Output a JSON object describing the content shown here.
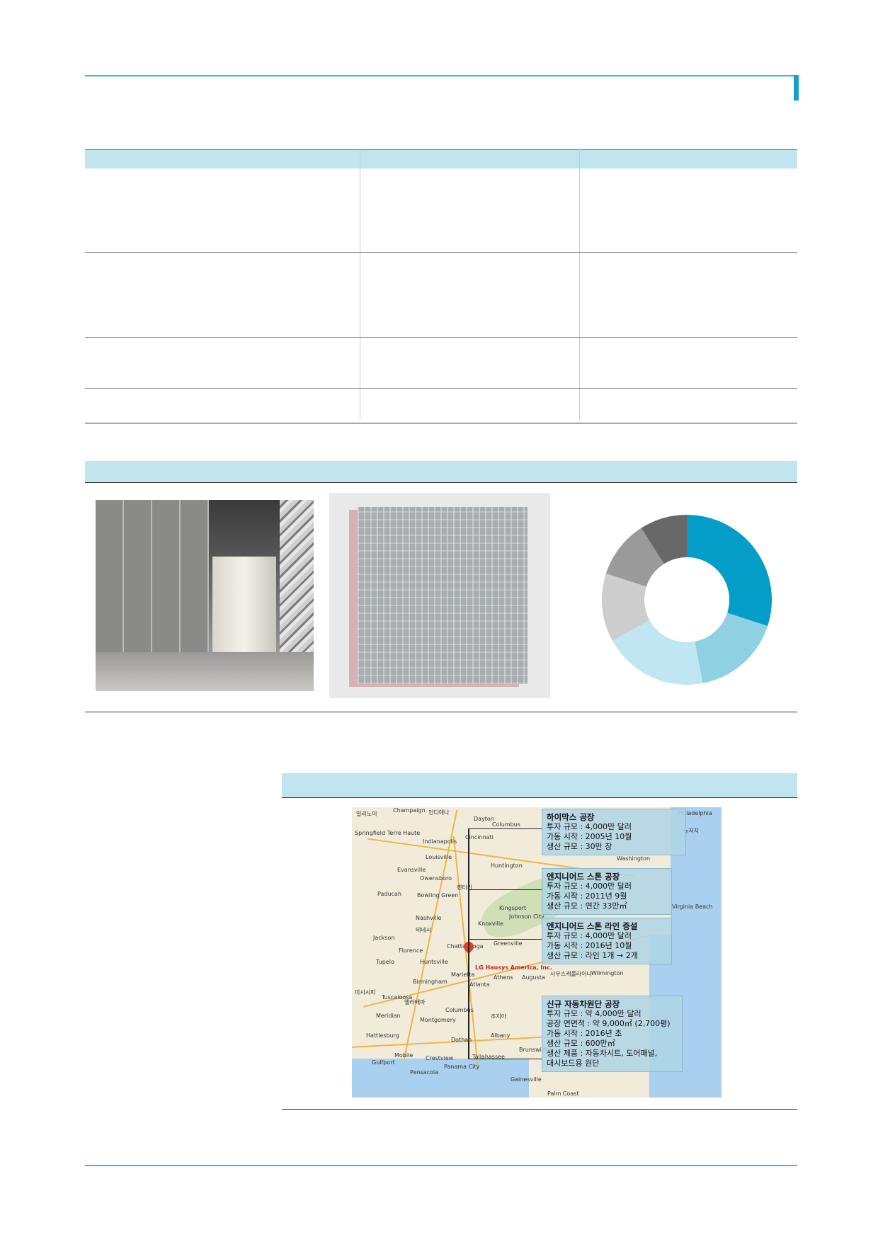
{
  "chart_data": {
    "type": "pie",
    "donut": true,
    "values": [
      30,
      17,
      20,
      13,
      11,
      9
    ],
    "colors": [
      "#049dc8",
      "#8fd1e3",
      "#bfe6f1",
      "#cdcdcd",
      "#9a9a9a",
      "#686868"
    ]
  },
  "map": {
    "pin_label": "LG Hausys America, Inc.",
    "cities": [
      "일리노이",
      "Champaign",
      "인디애나",
      "Springfield",
      "Terre Haute",
      "Indianapolis",
      "Cincinnati",
      "Columbus",
      "Dayton",
      "Philadelphia",
      "Louisville",
      "Evansville",
      "Owensboro",
      "Bowling Green",
      "Paducah",
      "Nashville",
      "Knoxville",
      "Kingsport",
      "Johnson City",
      "Washington",
      "Huntington",
      "Chattanooga",
      "Huntsville",
      "Florence",
      "Tupelo",
      "Jackson",
      "Birmingham",
      "Tuscaloosa",
      "Atlanta",
      "Athens",
      "Augusta",
      "Greenville",
      "Columbus",
      "Montgomery",
      "Dothan",
      "Mobile",
      "Tallahassee",
      "Pensacola",
      "Panama City",
      "Gulfport",
      "Hattiesburg",
      "Gainesville",
      "Wilmington",
      "Palm Coast",
      "미시시피",
      "앨라배마",
      "조지아",
      "테네시",
      "켄터키",
      "사우스캐롤라이나",
      "Meridian",
      "Albany",
      "Brunswick",
      "Marietta",
      "Crestview",
      "Virginia Beach",
      "뉴저지"
    ],
    "callouts": [
      {
        "title": "하이막스 공장",
        "lines": [
          "투자 규모 : 4,000만 달러",
          "가동 시작 : 2005년 10월",
          "생산 규모 : 30만 장"
        ]
      },
      {
        "title": "엔지니어드 스톤 공장",
        "lines": [
          "투자 규모 : 4,000만 달러",
          "가동 시작 : 2011년 9월",
          "생산 규모 : 연간 33만㎡"
        ]
      },
      {
        "title": "엔지니어드 스톤 라인 증설",
        "lines": [
          "투자 규모 : 4,000만 달러",
          "가동 시작 : 2016년 10월",
          "생산 규모 : 라인 1개 → 2개"
        ]
      },
      {
        "title": "신규 자동차원단 공장",
        "lines": [
          "투자 규모 : 약 4,000만 달러",
          "공장 연면적 : 약 9,000㎡ (2,700평)",
          "가동 시작 : 2016년 초",
          "생산 규모 : 600만㎡",
          "생산 제품 : 자동차시트, 도어패널,",
          "대시보드용 원단"
        ]
      }
    ]
  }
}
